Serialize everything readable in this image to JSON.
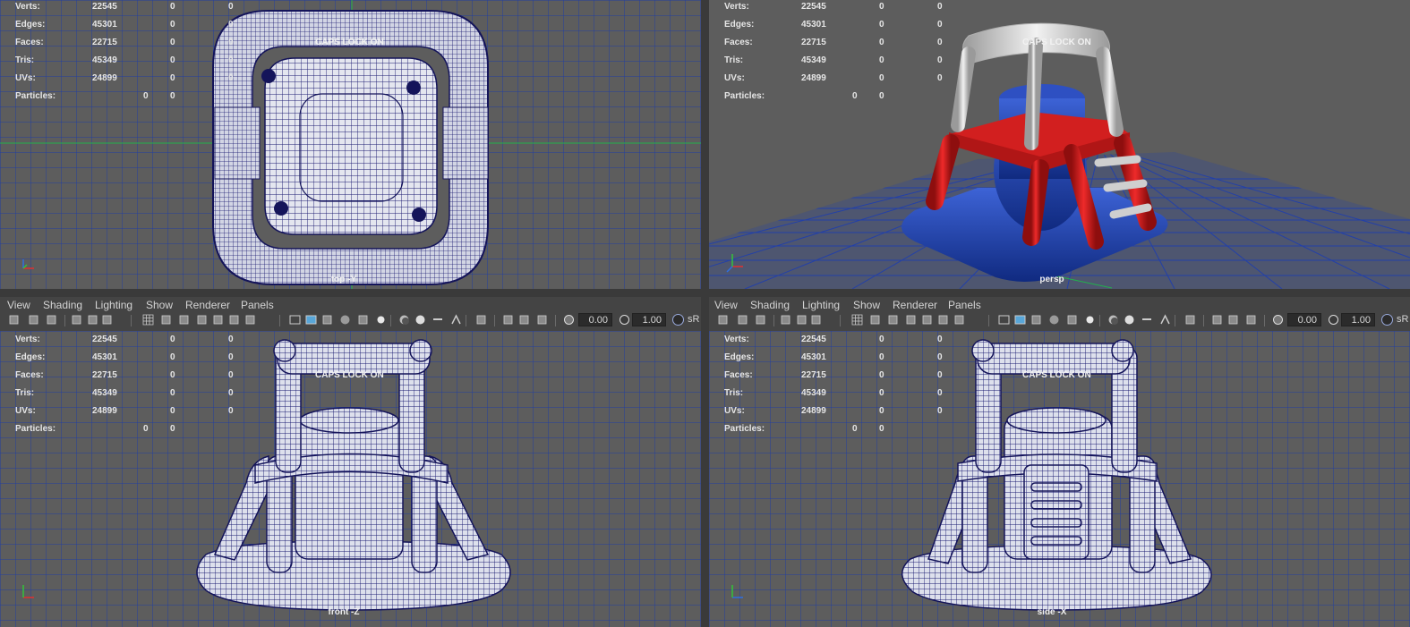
{
  "hud": {
    "labels": {
      "verts": "Verts:",
      "edges": "Edges:",
      "faces": "Faces:",
      "tris": "Tris:",
      "uvs": "UVs:",
      "particles": "Particles:"
    },
    "verts": [
      "22545",
      "0",
      "0"
    ],
    "edges": [
      "45301",
      "0",
      "0"
    ],
    "faces": [
      "22715",
      "0",
      "0"
    ],
    "tris": [
      "45349",
      "0",
      "0"
    ],
    "uvs": [
      "24899",
      "0",
      "0"
    ],
    "particles": [
      "0",
      "0"
    ]
  },
  "caps_lock": "CAPS LOCK ON",
  "viewports": {
    "top": {
      "camera": "top -Y"
    },
    "persp": {
      "camera": "persp"
    },
    "front": {
      "camera": "front -Z"
    },
    "side": {
      "camera": "side -X"
    }
  },
  "menu": [
    "View",
    "Shading",
    "Lighting",
    "Show",
    "Renderer",
    "Panels"
  ],
  "toolbar": {
    "exposure": "0.00",
    "gamma": "1.00",
    "color_space": "sR"
  },
  "colors": {
    "viewport_bg": "#5d5d5d",
    "grid": "#1f3fa4",
    "wire": "#1a1a6e",
    "inflatable_blue": "#1e3fa6",
    "inflatable_red": "#cc1a1a",
    "inflatable_white": "#d9d9d9"
  },
  "icons": [
    "camera-select-icon",
    "camera-attr-icon",
    "bookmark-icon",
    "image-plane-icon",
    "grease-pencil-icon",
    "move-tool-icon",
    "grid-icon",
    "film-gate-icon",
    "resolution-gate-icon",
    "gate-mask-icon",
    "field-chart-icon",
    "safe-action-icon",
    "safe-title-icon",
    "wireframe-icon",
    "smooth-shade-icon",
    "default-material-icon",
    "xray-icon",
    "shaded-wireframe-icon",
    "lights-icon",
    "shadows-icon",
    "ambient-occlusion-icon",
    "motion-blur-icon",
    "anti-alias-icon",
    "isolate-select-icon",
    "xray-joints-icon",
    "xray-active-icon",
    "backface-icon",
    "exposure-icon",
    "gamma-icon",
    "color-manage-icon"
  ]
}
